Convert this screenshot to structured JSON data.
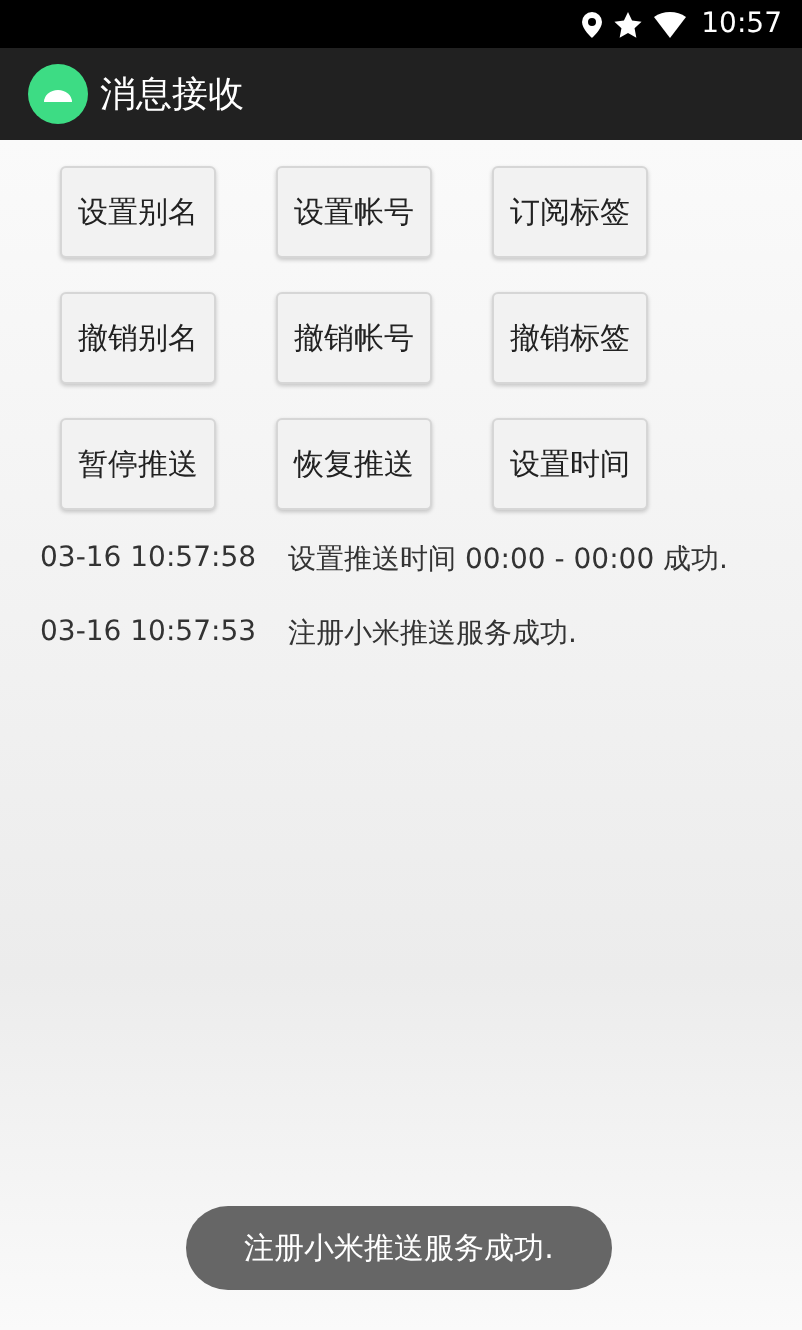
{
  "status_bar": {
    "time": "10:57"
  },
  "app_bar": {
    "title": "消息接收"
  },
  "buttons": [
    {
      "label": "设置别名"
    },
    {
      "label": "设置帐号"
    },
    {
      "label": "订阅标签"
    },
    {
      "label": "撤销别名"
    },
    {
      "label": "撤销帐号"
    },
    {
      "label": "撤销标签"
    },
    {
      "label": "暂停推送"
    },
    {
      "label": "恢复推送"
    },
    {
      "label": "设置时间"
    }
  ],
  "log": [
    {
      "time": "03-16 10:57:58",
      "message": "设置推送时间 00:00 - 00:00 成功."
    },
    {
      "time": "03-16 10:57:53",
      "message": "注册小米推送服务成功."
    }
  ],
  "toast": {
    "text": "注册小米推送服务成功."
  }
}
